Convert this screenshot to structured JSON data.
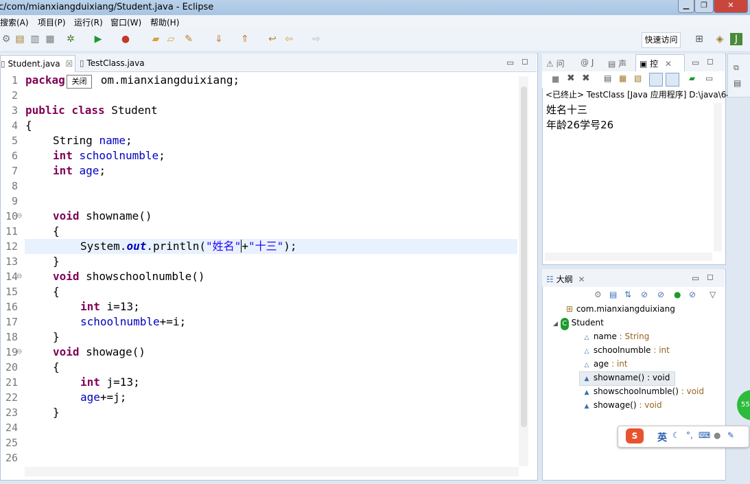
{
  "window": {
    "title": "c/com/mianxiangduixiang/Student.java  -  Eclipse"
  },
  "menu": [
    "搜索(A)",
    "项目(P)",
    "运行(R)",
    "窗口(W)",
    "帮助(H)"
  ],
  "toolbar": {
    "quick_access": "快速访问"
  },
  "editor": {
    "tabs": [
      "Student.java",
      "TestClass.java"
    ],
    "tooltip": "关闭",
    "lines": [
      {
        "n": "1"
      },
      {
        "n": "2"
      },
      {
        "n": "3"
      },
      {
        "n": "4"
      },
      {
        "n": "5"
      },
      {
        "n": "6"
      },
      {
        "n": "7"
      },
      {
        "n": "8"
      },
      {
        "n": "9"
      },
      {
        "n": "10"
      },
      {
        "n": "11"
      },
      {
        "n": "12"
      },
      {
        "n": "13"
      },
      {
        "n": "14"
      },
      {
        "n": "15"
      },
      {
        "n": "16"
      },
      {
        "n": "17"
      },
      {
        "n": "18"
      },
      {
        "n": "19"
      },
      {
        "n": "20"
      },
      {
        "n": "21"
      },
      {
        "n": "22"
      },
      {
        "n": "23"
      },
      {
        "n": "24"
      },
      {
        "n": "25"
      },
      {
        "n": "26"
      }
    ],
    "code": {
      "l1_kw": "packag",
      "l1_rest": "om.mianxiangduixiang;",
      "l3_kw": "public class",
      "l3_rest": " Student",
      "l4": "{",
      "l5_type": "String ",
      "l5_field": "name",
      "semi": ";",
      "l6_kw": "int ",
      "l6_field": "schoolnumble",
      "l7_kw": "int ",
      "l7_field": "age",
      "l10_kw": "void",
      "l10_rest": " showname()",
      "brace_open": "{",
      "brace_close": "}",
      "l12_a": "System.",
      "l12_out": "out",
      "l12_b": ".println(",
      "l12_s1": "\"姓名\"",
      "l12_plus": "+",
      "l12_s2": "\"十三\"",
      "l12_end": ");",
      "l14_kw": "void",
      "l14_rest": " showschoolnumble()",
      "l16_kw": "int",
      "l16_rest": " i=13;",
      "l17_field": "schoolnumble",
      "l17_rest": "+=i;",
      "l19_kw": "void",
      "l19_rest": " showage()",
      "l21_kw": "int",
      "l21_rest": " j=13;",
      "l22_field": "age",
      "l22_rest": "+=j;"
    }
  },
  "console": {
    "tabs": [
      "问",
      "@ J",
      "声",
      "控"
    ],
    "status": "<已终止> TestClass [Java 应用程序] D:\\java\\64",
    "output": [
      "姓名十三",
      "年龄26学号26"
    ]
  },
  "outline": {
    "tab": "大纲",
    "items": [
      {
        "name": "com.mianxiangduixiang",
        "type": ""
      },
      {
        "name": "Student",
        "type": ""
      },
      {
        "name": "name",
        "type": " : String"
      },
      {
        "name": "schoolnumble",
        "type": " : int"
      },
      {
        "name": "age",
        "type": " : int"
      },
      {
        "name": "showname()",
        "type": " : void"
      },
      {
        "name": "showschoolnumble()",
        "type": " : void"
      },
      {
        "name": "showage()",
        "type": " : void"
      }
    ]
  },
  "ime": {
    "label": "英"
  },
  "badge": "55"
}
